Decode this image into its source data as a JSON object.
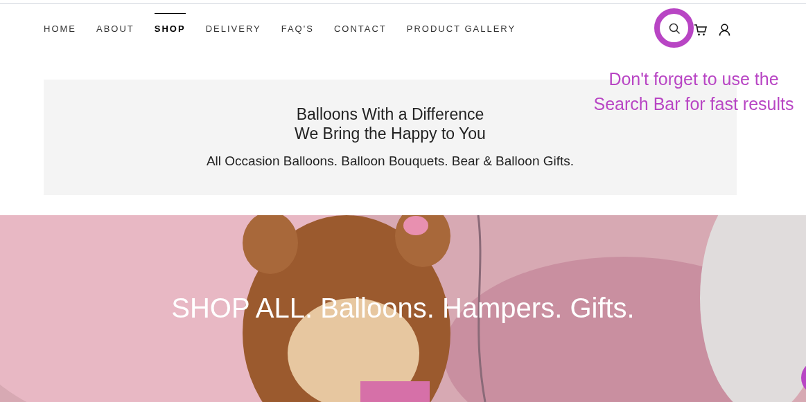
{
  "nav": {
    "items": [
      {
        "label": "HOME",
        "selected": false
      },
      {
        "label": "ABOUT",
        "selected": false
      },
      {
        "label": "SHOP",
        "selected": true
      },
      {
        "label": "DELIVERY",
        "selected": false
      },
      {
        "label": "FAQ'S",
        "selected": false
      },
      {
        "label": "CONTACT",
        "selected": false
      },
      {
        "label": "PRODUCT GALLERY",
        "selected": false
      }
    ]
  },
  "annotation": {
    "lines": [
      "Don't forget to use the",
      "Search Bar for fast results"
    ]
  },
  "banner": {
    "title_lines": [
      "Balloons With a Difference",
      "We Bring the Happy to You"
    ],
    "subtitle": "All Occasion Balloons. Balloon Bouquets. Bear & Balloon Gifts."
  },
  "hero": {
    "kind": "picture",
    "heading": "SHOP ALL. Balloons. Hampers. Gifts."
  }
}
